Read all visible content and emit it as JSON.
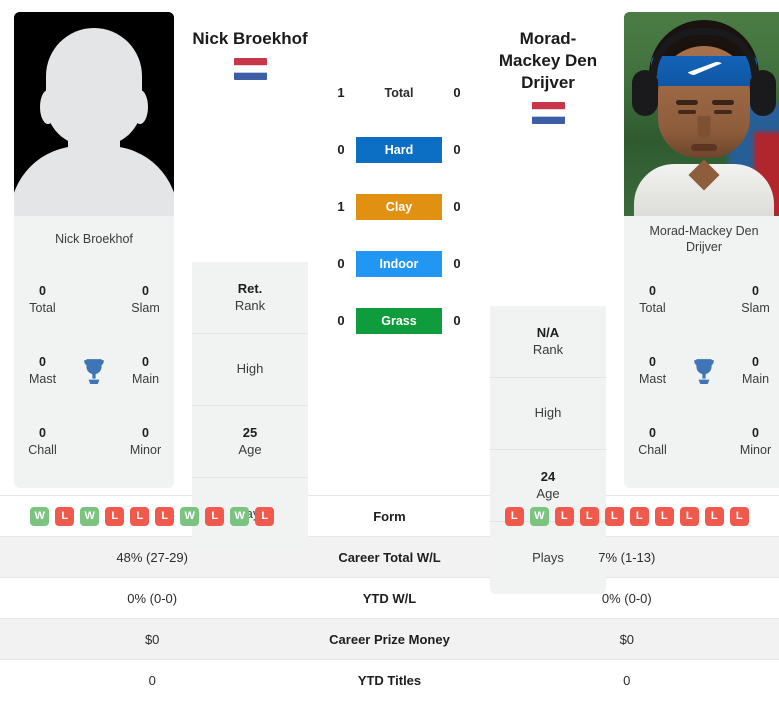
{
  "players": {
    "left": {
      "name": "Nick Broekhof",
      "photo_caption": "Nick Broekhof",
      "country": "Netherlands",
      "flag_icon": "netherlands-flag",
      "avatar_type": "placeholder-silhouette",
      "rank": "Ret.",
      "rank_label": "Rank",
      "high": "",
      "high_label": "High",
      "age": "25",
      "age_label": "Age",
      "plays": "",
      "plays_label": "Plays",
      "titles": [
        {
          "value": "0",
          "label": "Total"
        },
        {
          "value": "0",
          "label": "Slam"
        },
        {
          "value": "0",
          "label": "Mast"
        },
        {
          "value": "0",
          "label": "Main"
        },
        {
          "value": "0",
          "label": "Chall"
        },
        {
          "value": "0",
          "label": "Minor"
        }
      ]
    },
    "right": {
      "name": "Morad-Mackey Den Drijver",
      "photo_caption": "Morad-Mackey Den Drijver",
      "country": "Netherlands",
      "flag_icon": "netherlands-flag",
      "avatar_type": "photo",
      "rank": "N/A",
      "rank_label": "Rank",
      "high": "",
      "high_label": "High",
      "age": "24",
      "age_label": "Age",
      "plays": "",
      "plays_label": "Plays",
      "titles": [
        {
          "value": "0",
          "label": "Total"
        },
        {
          "value": "0",
          "label": "Slam"
        },
        {
          "value": "0",
          "label": "Mast"
        },
        {
          "value": "0",
          "label": "Main"
        },
        {
          "value": "0",
          "label": "Chall"
        },
        {
          "value": "0",
          "label": "Minor"
        }
      ]
    }
  },
  "surfaces": [
    {
      "label": "Total",
      "left": "1",
      "right": "0",
      "color": "transparent"
    },
    {
      "label": "Hard",
      "left": "0",
      "right": "0",
      "color": "#0d6fc4"
    },
    {
      "label": "Clay",
      "left": "1",
      "right": "0",
      "color": "#e09112"
    },
    {
      "label": "Indoor",
      "left": "0",
      "right": "0",
      "color": "#2196f3"
    },
    {
      "label": "Grass",
      "left": "0",
      "right": "0",
      "color": "#0e9c3c"
    }
  ],
  "trophy_icon": "trophy-icon",
  "colors": {
    "win_badge": "#7ac47f",
    "loss_badge": "#ef5a4c",
    "card_bg": "#f1f2f2",
    "row_alt_bg": "#f2f2f2",
    "trophy": "#3f74b5"
  },
  "comparison_rows": [
    {
      "label": "Form",
      "type": "form",
      "left_form": [
        "W",
        "L",
        "W",
        "L",
        "L",
        "L",
        "W",
        "L",
        "W",
        "L"
      ],
      "right_form": [
        "L",
        "W",
        "L",
        "L",
        "L",
        "L",
        "L",
        "L",
        "L",
        "L"
      ]
    },
    {
      "label": "Career Total W/L",
      "type": "text",
      "left": "48% (27-29)",
      "right": "7% (1-13)"
    },
    {
      "label": "YTD W/L",
      "type": "text",
      "left": "0% (0-0)",
      "right": "0% (0-0)"
    },
    {
      "label": "Career Prize Money",
      "type": "text",
      "left": "$0",
      "right": "$0"
    },
    {
      "label": "YTD Titles",
      "type": "text",
      "left": "0",
      "right": "0"
    }
  ]
}
